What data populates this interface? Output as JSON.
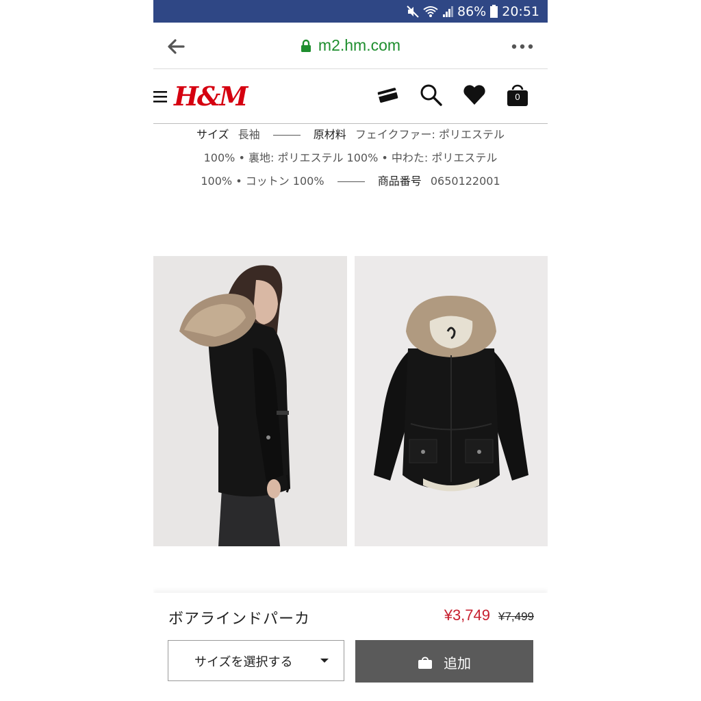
{
  "status": {
    "battery": "86%",
    "time": "20:51"
  },
  "browser": {
    "url": "m2.hm.com"
  },
  "header": {
    "logo": "H&M",
    "bag_count": "0"
  },
  "description": {
    "size_label": "サイズ",
    "size_value": "長袖",
    "material_label": "原材料",
    "material_line1": "フェイクファー: ポリエステル",
    "material_line2": "100% • 裏地: ポリエステル 100% • 中わた: ポリエステル",
    "material_line3": "100% • コットン 100%",
    "article_label": "商品番号",
    "article_value": "0650122001"
  },
  "product": {
    "name": "ボアラインドパーカ",
    "price": "¥3,749",
    "old_price": "¥7,499",
    "size_select_label": "サイズを選択する",
    "add_label": "追加"
  },
  "colors": {
    "status_bar": "#2f4785",
    "url_green": "#1e8e2e",
    "brand_red": "#d50010",
    "price_red": "#c7202f",
    "add_button": "#5a5a5a"
  }
}
